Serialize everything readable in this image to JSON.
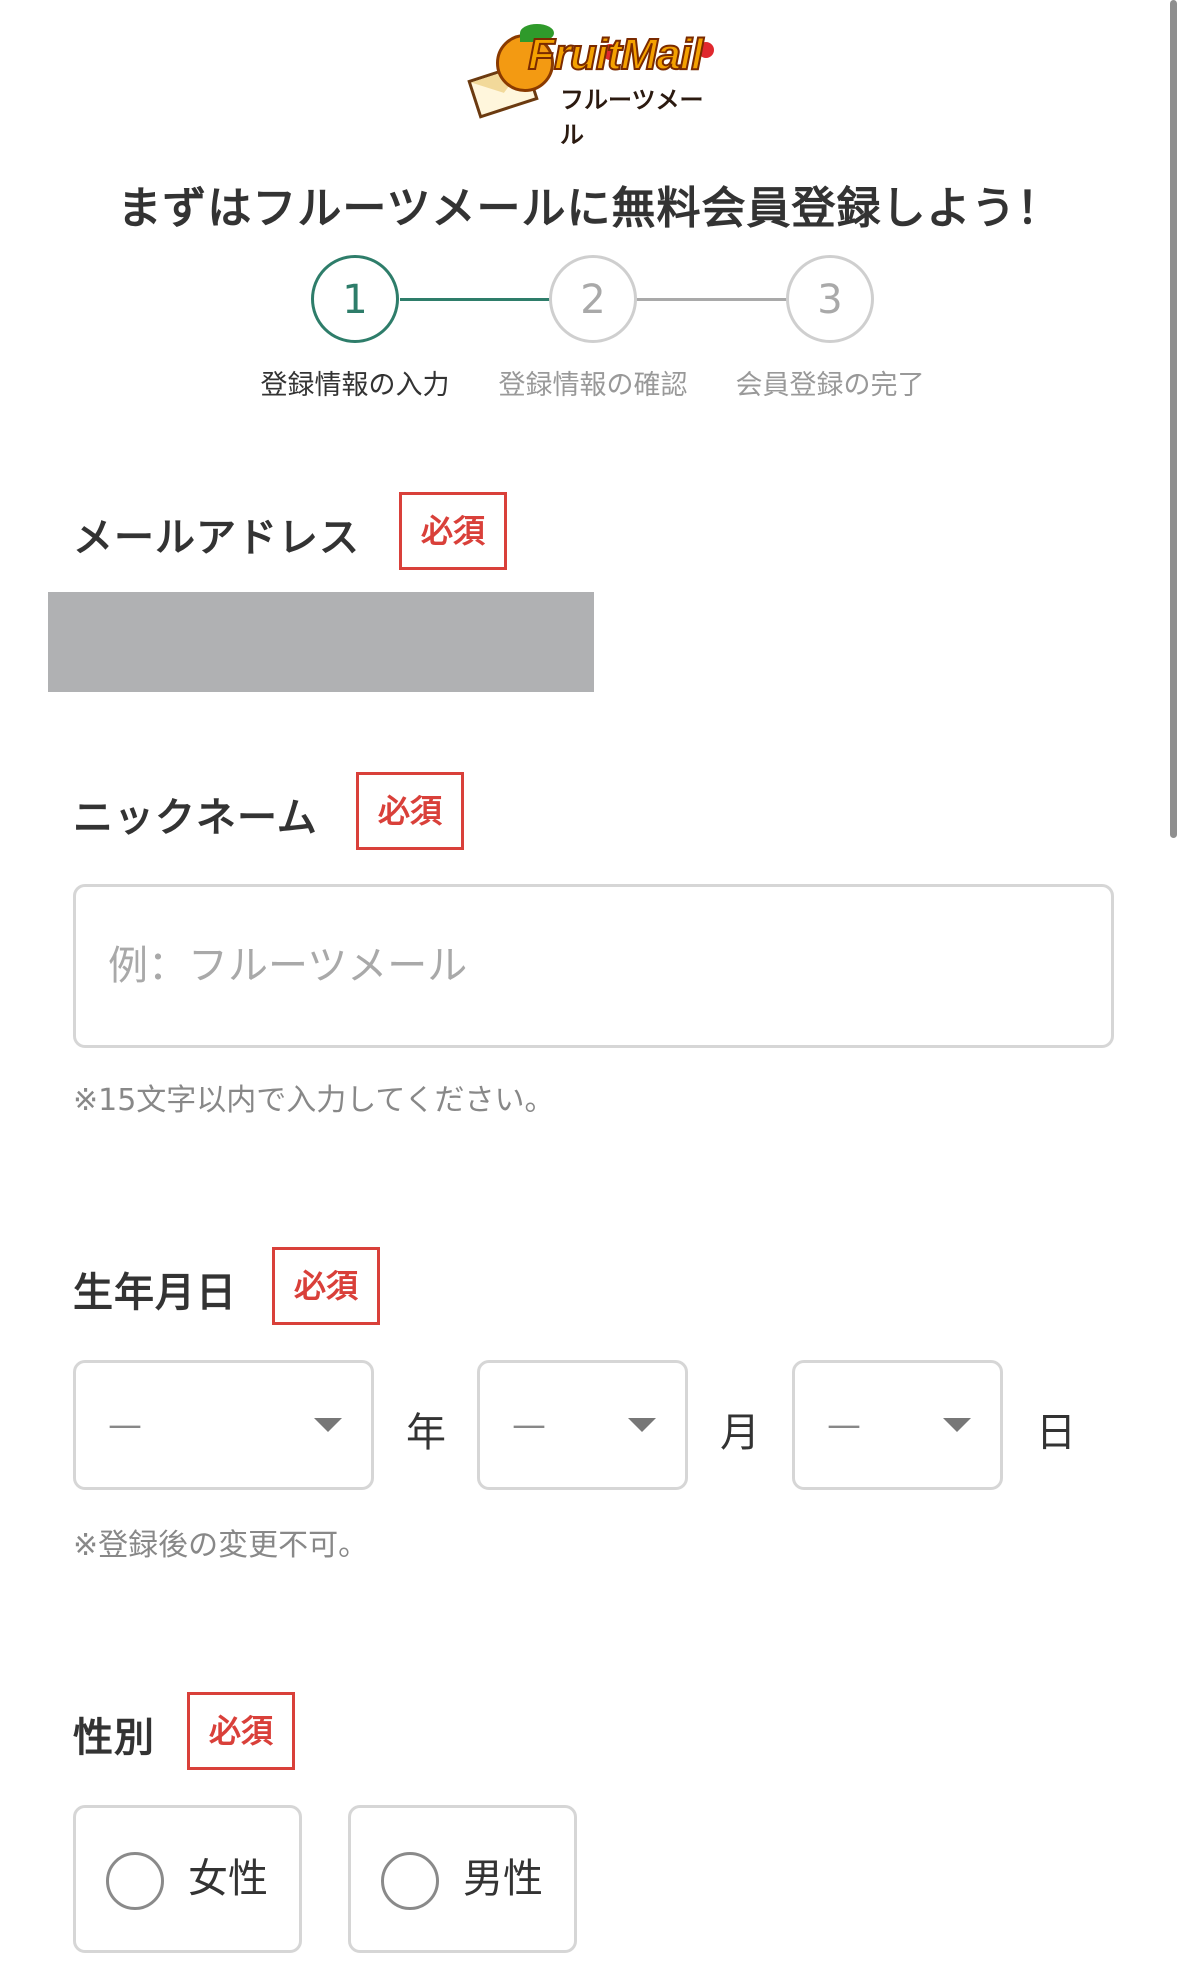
{
  "logo": {
    "word": "FruitMail",
    "kana": "フルーツメール"
  },
  "page_title": "まずはフルーツメールに無料会員登録しよう！",
  "stepper": {
    "steps": [
      {
        "number": "1",
        "label": "登録情報の入力",
        "active": true
      },
      {
        "number": "2",
        "label": "登録情報の確認",
        "active": false
      },
      {
        "number": "3",
        "label": "会員登録の完了",
        "active": false
      }
    ],
    "colors": {
      "active": "#2e7d6a",
      "inactive": "#cfcfcf",
      "active_text": "#333333",
      "inactive_text": "#999999"
    }
  },
  "required_label": "必須",
  "email": {
    "label": "メールアドレス",
    "value_hidden": true
  },
  "nickname": {
    "label": "ニックネーム",
    "value": "",
    "placeholder": "例：フルーツメール",
    "note": "※15文字以内で入力してください。"
  },
  "birthday": {
    "label": "生年月日",
    "year": {
      "value": "—",
      "unit": "年"
    },
    "month": {
      "value": "—",
      "unit": "月"
    },
    "day": {
      "value": "—",
      "unit": "日"
    },
    "note": "※登録後の変更不可。"
  },
  "gender": {
    "label": "性別",
    "options": [
      {
        "label": "女性",
        "selected": false
      },
      {
        "label": "男性",
        "selected": false
      }
    ]
  },
  "colors": {
    "required_red": "#d9403a",
    "border_gray": "#d6d6d6",
    "masked_gray": "#b0b1b3"
  }
}
